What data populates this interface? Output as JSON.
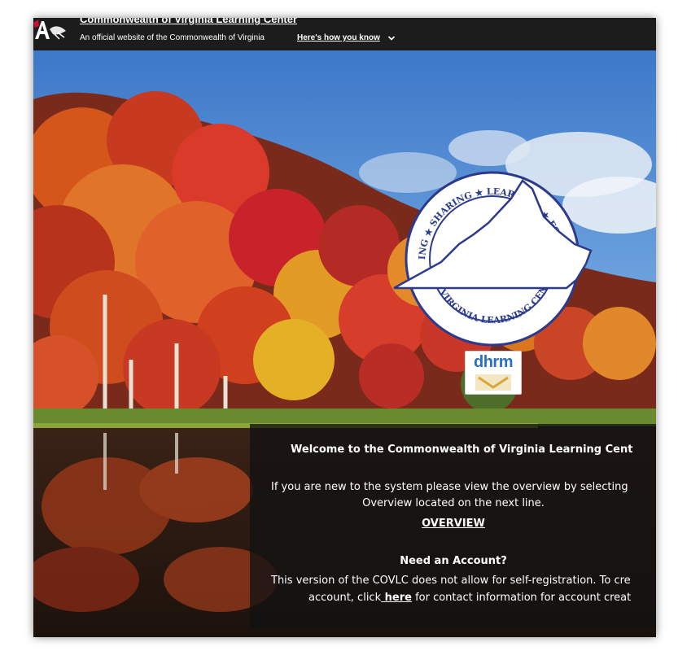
{
  "banner": {
    "site_title": "Commonwealth of Virginia Learning Center",
    "official_text": "An official website of the Commonwealth of Virginia",
    "how_link": "Here's how you know"
  },
  "seal": {
    "top_text": "TRAINING ★ SHARING ★ LEARNING ★ FOR SUCCESS",
    "bottom_text": "THE VIRGINIA LEARNING CENTER"
  },
  "dhrm_logo": {
    "text": "dhrm"
  },
  "welcome": {
    "title": "Welcome to the Commonwealth of Virginia Learning Cent",
    "intro_line1": "If you are new to the system please view the overview by selecting",
    "intro_line2": "Overview located on the next line.",
    "overview_link": "OVERVIEW",
    "need_account": "Need an Account?",
    "version_text": "This version of the COVLC does not allow for self-registration. To cre",
    "account_prefix": "account, click",
    "here_link": " here",
    "account_suffix": " for contact information for account creat"
  },
  "colors": {
    "banner_bg": "#1c1c1c",
    "seal_blue": "#2b3a8c",
    "dhrm_blue": "#2a6fc0",
    "panel_bg": "rgba(18,18,18,0.78)"
  }
}
